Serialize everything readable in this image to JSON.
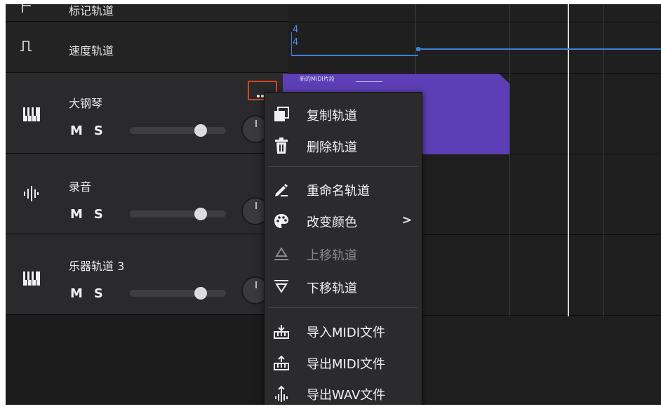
{
  "tracks": {
    "marker": {
      "name": "标记轨道",
      "icon": "flag-icon"
    },
    "tempo": {
      "name": "速度轨道",
      "icon": "tempo-step-icon"
    },
    "instruments": [
      {
        "name": "大钢琴",
        "icon": "piano-keys-icon",
        "mute": "M",
        "solo": "S",
        "volume_fraction": 0.74
      },
      {
        "name": "录音",
        "icon": "audio-wave-icon",
        "mute": "M",
        "solo": "S",
        "volume_fraction": 0.74
      },
      {
        "name": "乐器轨道 3",
        "icon": "piano-keys-icon",
        "mute": "M",
        "solo": "S",
        "volume_fraction": 0.74
      }
    ]
  },
  "timeline": {
    "time_signature_top": "4",
    "time_signature_bottom": "4",
    "clip_label": "新的MIDI片段",
    "clip_color": "#5c3fb6",
    "tempo_color": "#3f7fd9"
  },
  "more_button": {
    "icon": "more-dots-icon",
    "highlight_color": "#d9441f"
  },
  "context_menu": {
    "items": [
      {
        "label": "复制轨道",
        "icon": "copy-icon"
      },
      {
        "label": "删除轨道",
        "icon": "trash-icon"
      },
      {
        "label": "重命名轨道",
        "icon": "rename-pen-icon"
      },
      {
        "label": "改变颜色",
        "icon": "palette-icon",
        "submenu": ">"
      },
      {
        "label": "上移轨道",
        "icon": "move-up-icon",
        "disabled": true
      },
      {
        "label": "下移轨道",
        "icon": "move-down-icon"
      },
      {
        "label": "导入MIDI文件",
        "icon": "midi-import-icon"
      },
      {
        "label": "导出MIDI文件",
        "icon": "midi-export-icon"
      },
      {
        "label": "导出WAV文件",
        "icon": "wav-export-icon"
      }
    ]
  }
}
